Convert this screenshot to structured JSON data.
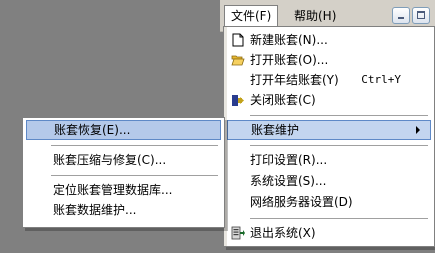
{
  "menubar": {
    "file_label": "文件(F)",
    "help_label": "帮助(H)"
  },
  "file_menu": {
    "items": [
      {
        "label": "新建账套(N)...",
        "icon": "new-document-icon"
      },
      {
        "label": "打开账套(O)...",
        "icon": "open-folder-icon"
      },
      {
        "label": "打开年结账套(Y)",
        "shortcut": "Ctrl+Y"
      },
      {
        "label": "关闭账套(C)",
        "icon": "close-account-icon"
      },
      {
        "label": "账套维护",
        "has_submenu": true,
        "highlighted": true
      },
      {
        "label": "打印设置(R)..."
      },
      {
        "label": "系统设置(S)..."
      },
      {
        "label": "网络服务器设置(D)"
      },
      {
        "label": "退出系统(X)",
        "icon": "exit-icon"
      }
    ]
  },
  "submenu": {
    "items": [
      {
        "label": "账套恢复(E)...",
        "highlighted": true
      },
      {
        "label": "账套压缩与修复(C)..."
      },
      {
        "label": "定位账套管理数据库..."
      },
      {
        "label": "账套数据维护..."
      }
    ]
  },
  "colors": {
    "desktop": "#808080",
    "menu_bg": "#ffffff",
    "highlight_bg": "#c3d5ef",
    "highlight_border": "#5e89c7"
  }
}
